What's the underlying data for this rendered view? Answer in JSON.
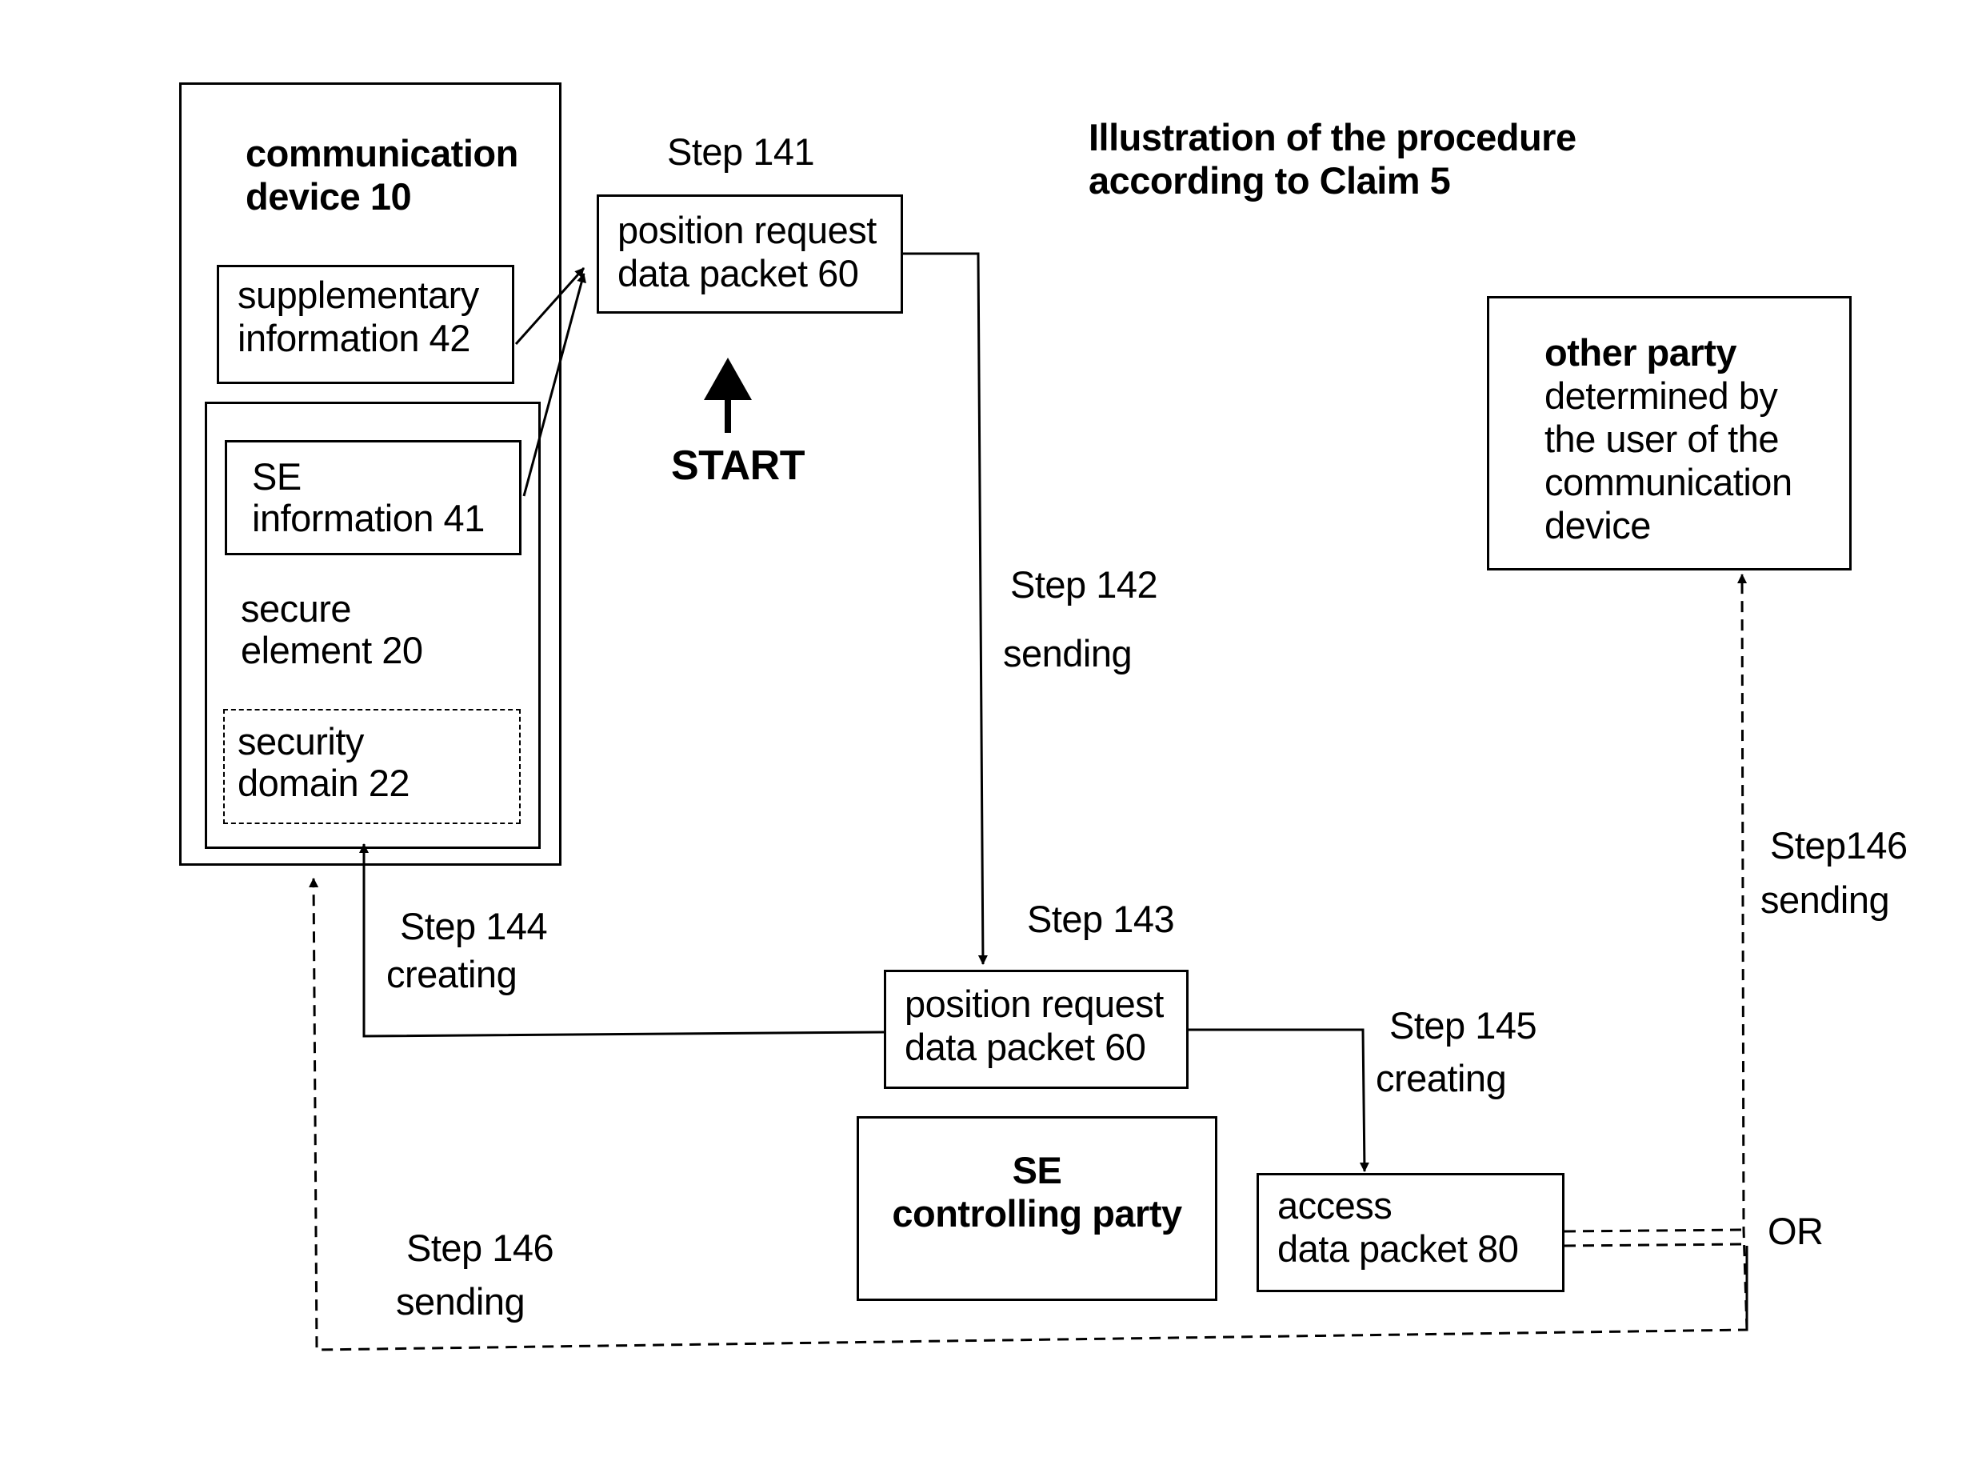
{
  "title": [
    "Illustration of the procedure",
    "according to Claim 5"
  ],
  "communication_device": {
    "label": [
      "communication",
      "device 10"
    ]
  },
  "supplementary_information": {
    "label": [
      "supplementary",
      "information 42"
    ]
  },
  "secure_element": {
    "label": [
      "secure",
      "element 20"
    ],
    "se_information": [
      "SE",
      "information 41"
    ],
    "security_domain": [
      "security",
      "domain 22"
    ]
  },
  "position_request_1": [
    "position request",
    "data packet 60"
  ],
  "position_request_2": [
    "position request",
    "data packet  60"
  ],
  "start": "START",
  "other_party": {
    "title": "other party",
    "lines": [
      "determined by",
      "the user of the",
      "communication",
      "device"
    ]
  },
  "se_controlling_party": [
    "SE",
    "controlling party"
  ],
  "access_packet": [
    "access",
    "data packet 80"
  ],
  "steps": {
    "s141": "Step 141",
    "s142": [
      "Step 142",
      "sending"
    ],
    "s143": "Step 143",
    "s144": [
      "Step 144",
      "creating"
    ],
    "s145": [
      "Step 145",
      "creating"
    ],
    "s146_left": [
      "Step 146",
      "sending"
    ],
    "s146_right": [
      "Step146",
      "sending"
    ]
  },
  "or_label": "OR"
}
